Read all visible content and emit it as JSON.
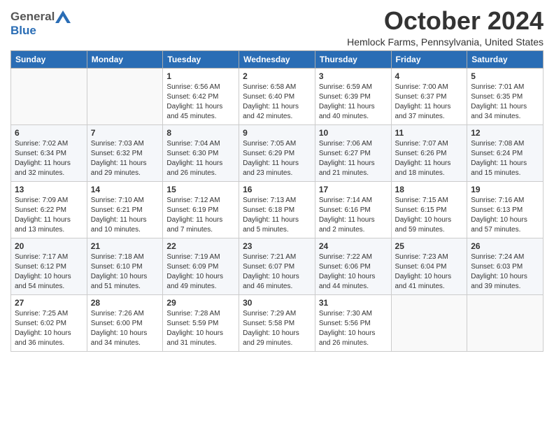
{
  "header": {
    "logo_general": "General",
    "logo_blue": "Blue",
    "month_title": "October 2024",
    "location": "Hemlock Farms, Pennsylvania, United States"
  },
  "weekdays": [
    "Sunday",
    "Monday",
    "Tuesday",
    "Wednesday",
    "Thursday",
    "Friday",
    "Saturday"
  ],
  "weeks": [
    [
      {
        "day": "",
        "info": ""
      },
      {
        "day": "",
        "info": ""
      },
      {
        "day": "1",
        "info": "Sunrise: 6:56 AM\nSunset: 6:42 PM\nDaylight: 11 hours and 45 minutes."
      },
      {
        "day": "2",
        "info": "Sunrise: 6:58 AM\nSunset: 6:40 PM\nDaylight: 11 hours and 42 minutes."
      },
      {
        "day": "3",
        "info": "Sunrise: 6:59 AM\nSunset: 6:39 PM\nDaylight: 11 hours and 40 minutes."
      },
      {
        "day": "4",
        "info": "Sunrise: 7:00 AM\nSunset: 6:37 PM\nDaylight: 11 hours and 37 minutes."
      },
      {
        "day": "5",
        "info": "Sunrise: 7:01 AM\nSunset: 6:35 PM\nDaylight: 11 hours and 34 minutes."
      }
    ],
    [
      {
        "day": "6",
        "info": "Sunrise: 7:02 AM\nSunset: 6:34 PM\nDaylight: 11 hours and 32 minutes."
      },
      {
        "day": "7",
        "info": "Sunrise: 7:03 AM\nSunset: 6:32 PM\nDaylight: 11 hours and 29 minutes."
      },
      {
        "day": "8",
        "info": "Sunrise: 7:04 AM\nSunset: 6:30 PM\nDaylight: 11 hours and 26 minutes."
      },
      {
        "day": "9",
        "info": "Sunrise: 7:05 AM\nSunset: 6:29 PM\nDaylight: 11 hours and 23 minutes."
      },
      {
        "day": "10",
        "info": "Sunrise: 7:06 AM\nSunset: 6:27 PM\nDaylight: 11 hours and 21 minutes."
      },
      {
        "day": "11",
        "info": "Sunrise: 7:07 AM\nSunset: 6:26 PM\nDaylight: 11 hours and 18 minutes."
      },
      {
        "day": "12",
        "info": "Sunrise: 7:08 AM\nSunset: 6:24 PM\nDaylight: 11 hours and 15 minutes."
      }
    ],
    [
      {
        "day": "13",
        "info": "Sunrise: 7:09 AM\nSunset: 6:22 PM\nDaylight: 11 hours and 13 minutes."
      },
      {
        "day": "14",
        "info": "Sunrise: 7:10 AM\nSunset: 6:21 PM\nDaylight: 11 hours and 10 minutes."
      },
      {
        "day": "15",
        "info": "Sunrise: 7:12 AM\nSunset: 6:19 PM\nDaylight: 11 hours and 7 minutes."
      },
      {
        "day": "16",
        "info": "Sunrise: 7:13 AM\nSunset: 6:18 PM\nDaylight: 11 hours and 5 minutes."
      },
      {
        "day": "17",
        "info": "Sunrise: 7:14 AM\nSunset: 6:16 PM\nDaylight: 11 hours and 2 minutes."
      },
      {
        "day": "18",
        "info": "Sunrise: 7:15 AM\nSunset: 6:15 PM\nDaylight: 10 hours and 59 minutes."
      },
      {
        "day": "19",
        "info": "Sunrise: 7:16 AM\nSunset: 6:13 PM\nDaylight: 10 hours and 57 minutes."
      }
    ],
    [
      {
        "day": "20",
        "info": "Sunrise: 7:17 AM\nSunset: 6:12 PM\nDaylight: 10 hours and 54 minutes."
      },
      {
        "day": "21",
        "info": "Sunrise: 7:18 AM\nSunset: 6:10 PM\nDaylight: 10 hours and 51 minutes."
      },
      {
        "day": "22",
        "info": "Sunrise: 7:19 AM\nSunset: 6:09 PM\nDaylight: 10 hours and 49 minutes."
      },
      {
        "day": "23",
        "info": "Sunrise: 7:21 AM\nSunset: 6:07 PM\nDaylight: 10 hours and 46 minutes."
      },
      {
        "day": "24",
        "info": "Sunrise: 7:22 AM\nSunset: 6:06 PM\nDaylight: 10 hours and 44 minutes."
      },
      {
        "day": "25",
        "info": "Sunrise: 7:23 AM\nSunset: 6:04 PM\nDaylight: 10 hours and 41 minutes."
      },
      {
        "day": "26",
        "info": "Sunrise: 7:24 AM\nSunset: 6:03 PM\nDaylight: 10 hours and 39 minutes."
      }
    ],
    [
      {
        "day": "27",
        "info": "Sunrise: 7:25 AM\nSunset: 6:02 PM\nDaylight: 10 hours and 36 minutes."
      },
      {
        "day": "28",
        "info": "Sunrise: 7:26 AM\nSunset: 6:00 PM\nDaylight: 10 hours and 34 minutes."
      },
      {
        "day": "29",
        "info": "Sunrise: 7:28 AM\nSunset: 5:59 PM\nDaylight: 10 hours and 31 minutes."
      },
      {
        "day": "30",
        "info": "Sunrise: 7:29 AM\nSunset: 5:58 PM\nDaylight: 10 hours and 29 minutes."
      },
      {
        "day": "31",
        "info": "Sunrise: 7:30 AM\nSunset: 5:56 PM\nDaylight: 10 hours and 26 minutes."
      },
      {
        "day": "",
        "info": ""
      },
      {
        "day": "",
        "info": ""
      }
    ]
  ]
}
